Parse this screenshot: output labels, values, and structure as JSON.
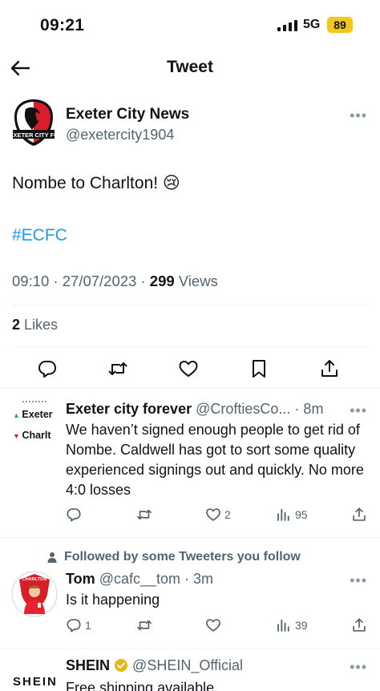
{
  "status_bar": {
    "time": "09:21",
    "network": "5G",
    "battery": "89",
    "battery_color": "#f5c518"
  },
  "nav": {
    "back_icon": "arrow-left-icon",
    "title": "Tweet"
  },
  "tweet": {
    "author_name": "Exeter City News",
    "author_handle": "@exetercity1904",
    "logo_text": "EXETER CITY FC",
    "text": "Nombe to Charlton! 😢",
    "hashtag": "#ECFC",
    "meta_prefix": "09:10 · 27/07/2023 · ",
    "views_count": "299",
    "views_label": " Views",
    "likes_count": "2",
    "likes_label": " Likes",
    "hashtag_color": "#1d9bf0"
  },
  "actions": [
    "reply-icon",
    "retweet-icon",
    "like-icon",
    "bookmark-icon",
    "share-icon"
  ],
  "replies": [
    {
      "name": "Exeter city forever",
      "handle": "@CroftiesCo...",
      "time": "· 8m",
      "avatar_lines": [
        "Exeter",
        "Charlt"
      ],
      "text": "We haven’t signed enough people to get rid of Nombe. Caldwell has got to sort some quality experienced signings out and quickly. No more 4:0 losses",
      "replies": "",
      "retweets": "",
      "likes": "2",
      "views": "95"
    },
    {
      "followed_label": "Followed by some Tweeters you follow",
      "name": "Tom",
      "handle": "@cafc__tom",
      "time": "· 3m",
      "avatar_text": "CHARLTON",
      "text": "Is it happening",
      "replies": "1",
      "retweets": "",
      "likes": "",
      "views": "39"
    },
    {
      "name": "SHEIN",
      "handle": "@SHEIN_Official",
      "logo_text": "SHEIN",
      "text": "Free shipping available"
    }
  ]
}
